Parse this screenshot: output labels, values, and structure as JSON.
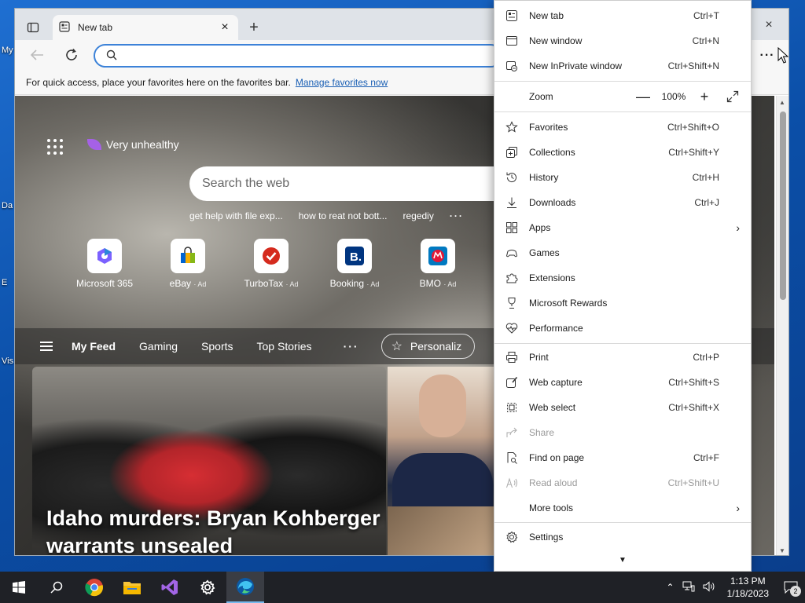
{
  "desktop": {
    "fragments": [
      "My",
      "Da",
      "E",
      "Vis"
    ]
  },
  "tab": {
    "title": "New tab",
    "close": "×"
  },
  "new_tab_symbol": "+",
  "window_close": "×",
  "address_bar": {
    "value": "",
    "placeholder": ""
  },
  "more_symbol": "···",
  "favorites_bar": {
    "message": "For quick access, place your favorites here on the favorites bar.",
    "link": "Manage favorites now"
  },
  "ntp": {
    "aqi_label": "Very unhealthy",
    "search_placeholder": "Search the web",
    "suggestions": [
      "get help with file exp...",
      "how to reat not bott...",
      "regediy"
    ],
    "suggestions_more": "···",
    "quick_links": [
      {
        "label": "Microsoft 365",
        "ad": ""
      },
      {
        "label": "eBay",
        "ad": "Ad"
      },
      {
        "label": "TurboTax",
        "ad": "Ad"
      },
      {
        "label": "Booking",
        "ad": "Ad"
      },
      {
        "label": "BMO",
        "ad": "Ad"
      }
    ],
    "feed_tabs": [
      "My Feed",
      "Gaming",
      "Sports",
      "Top Stories"
    ],
    "feed_more": "···",
    "personalize": "Personaliz",
    "headline": "Idaho murders: Bryan Kohberger search warrants unsealed"
  },
  "menu": {
    "items": [
      {
        "label": "New tab",
        "shortcut": "Ctrl+T"
      },
      {
        "label": "New window",
        "shortcut": "Ctrl+N"
      },
      {
        "label": "New InPrivate window",
        "shortcut": "Ctrl+Shift+N"
      },
      {
        "label": "Favorites",
        "shortcut": "Ctrl+Shift+O"
      },
      {
        "label": "Collections",
        "shortcut": "Ctrl+Shift+Y"
      },
      {
        "label": "History",
        "shortcut": "Ctrl+H"
      },
      {
        "label": "Downloads",
        "shortcut": "Ctrl+J"
      },
      {
        "label": "Apps",
        "shortcut": ""
      },
      {
        "label": "Games",
        "shortcut": ""
      },
      {
        "label": "Extensions",
        "shortcut": ""
      },
      {
        "label": "Microsoft Rewards",
        "shortcut": ""
      },
      {
        "label": "Performance",
        "shortcut": ""
      },
      {
        "label": "Print",
        "shortcut": "Ctrl+P"
      },
      {
        "label": "Web capture",
        "shortcut": "Ctrl+Shift+S"
      },
      {
        "label": "Web select",
        "shortcut": "Ctrl+Shift+X"
      },
      {
        "label": "Share",
        "shortcut": ""
      },
      {
        "label": "Find on page",
        "shortcut": "Ctrl+F"
      },
      {
        "label": "Read aloud",
        "shortcut": "Ctrl+Shift+U"
      },
      {
        "label": "More tools",
        "shortcut": ""
      },
      {
        "label": "Settings",
        "shortcut": ""
      }
    ],
    "zoom": {
      "label": "Zoom",
      "minus": "—",
      "value": "100%",
      "plus": "+"
    }
  },
  "taskbar": {
    "time": "1:13 PM",
    "date": "1/18/2023",
    "notification_count": "2"
  },
  "colors": {
    "accent": "#3c82d8",
    "taskbar": "#1f2126",
    "desktop": "#0b4fa8"
  }
}
